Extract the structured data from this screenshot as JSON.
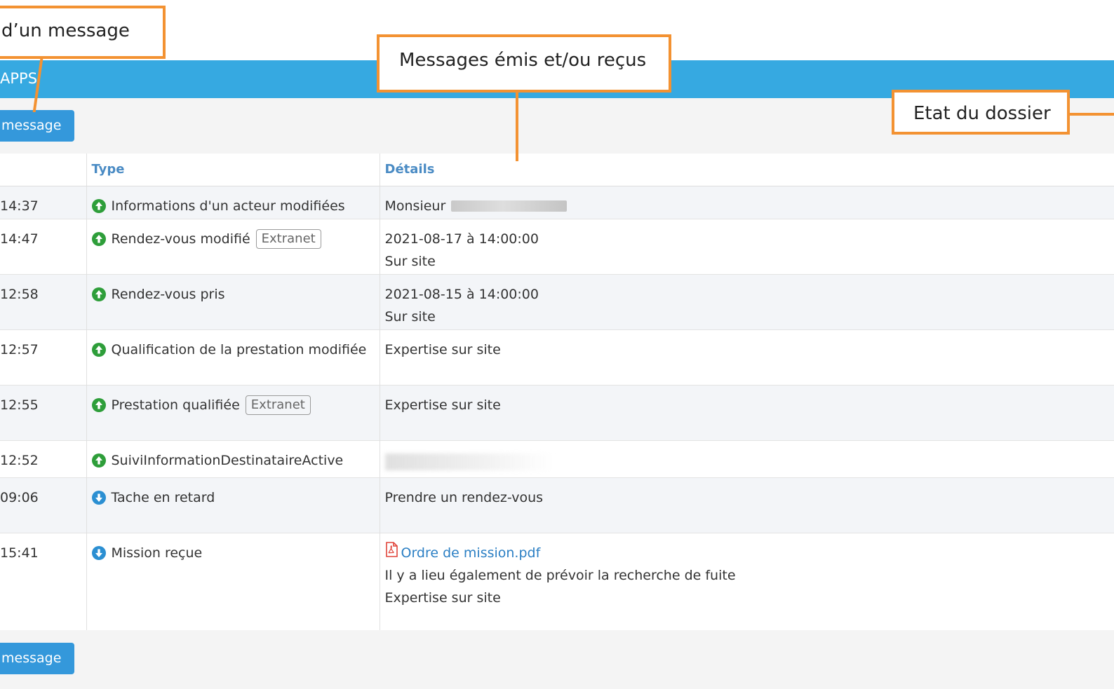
{
  "app": {
    "title": "APPS"
  },
  "buttons": {
    "top_message": "message",
    "bottom_message": "message"
  },
  "table": {
    "headers": {
      "time": "",
      "type": "Type",
      "details": "Détails"
    },
    "rows": [
      {
        "time": "14:37",
        "type": "Informations d'un acteur modifiées",
        "icon": "arrow-up-circle-icon",
        "tag": "",
        "details": [
          "Monsieur"
        ],
        "redacted": "bar"
      },
      {
        "time": "14:47",
        "type": "Rendez-vous modifié",
        "icon": "arrow-up-circle-icon",
        "tag": "Extranet",
        "details": [
          "2021-08-17 à 14:00:00",
          "Sur site"
        ],
        "redacted": ""
      },
      {
        "time": "12:58",
        "type": "Rendez-vous pris",
        "icon": "arrow-up-circle-icon",
        "tag": "",
        "details": [
          "2021-08-15 à 14:00:00",
          "Sur site"
        ],
        "redacted": ""
      },
      {
        "time": "12:57",
        "type": "Qualification de la prestation modifiée",
        "icon": "arrow-up-circle-icon",
        "tag": "",
        "details": [
          "Expertise sur site"
        ],
        "redacted": ""
      },
      {
        "time": "12:55",
        "type": "Prestation qualifiée",
        "icon": "arrow-up-circle-icon",
        "tag": "Extranet",
        "details": [
          "Expertise sur site"
        ],
        "redacted": ""
      },
      {
        "time": "12:52",
        "type": "SuiviInformationDestinataireActive",
        "icon": "arrow-up-circle-icon",
        "tag": "",
        "details": [],
        "redacted": "blur"
      },
      {
        "time": "09:06",
        "type": "Tache en retard",
        "icon": "arrow-down-circle-icon",
        "tag": "",
        "details": [
          "Prendre un rendez-vous"
        ],
        "redacted": ""
      },
      {
        "time": "15:41",
        "type": "Mission reçue",
        "icon": "arrow-down-circle-icon",
        "tag": "",
        "link": "Ordre de mission.pdf",
        "details": [
          "Il y a lieu également de prévoir la recherche de fuite",
          "Expertise sur site"
        ],
        "redacted": ""
      }
    ]
  },
  "callouts": {
    "message_sending": "d’un message",
    "messages_sent_received": "Messages émis et/ou reçus",
    "file_status": "Etat du dossier"
  },
  "colors": {
    "banner": "#36a9e1",
    "button": "#3498db",
    "callout_border": "#f39232",
    "header_text": "#4a8bc4",
    "icon_up": "#2e9e3a",
    "icon_down": "#2b8fd2",
    "pdf_link": "#2b7fc4"
  }
}
